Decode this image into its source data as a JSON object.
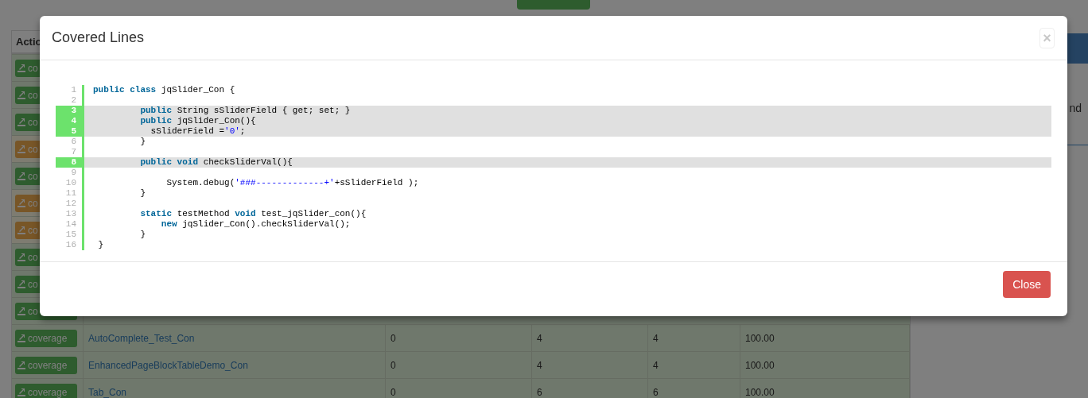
{
  "page": {
    "table": {
      "columns": [
        {
          "label": "Actio"
        }
      ],
      "rows": [
        {
          "kind": "success",
          "button": "co"
        },
        {
          "kind": "success",
          "button": "co"
        },
        {
          "kind": "success",
          "button": "co"
        },
        {
          "kind": "warning",
          "button": "co"
        },
        {
          "kind": "success",
          "button": "co"
        },
        {
          "kind": "warning",
          "button": "co"
        },
        {
          "kind": "warning",
          "button": "co"
        },
        {
          "kind": "success",
          "button": "co"
        },
        {
          "kind": "success",
          "button": "co"
        },
        {
          "kind": "success",
          "button": "co"
        },
        {
          "kind": "success",
          "button": "coverage",
          "cells": [
            "AutoComplete_Test_Con",
            "0",
            "4",
            "4",
            "100.00"
          ]
        },
        {
          "kind": "success",
          "button": "coverage",
          "cells": [
            "EnhancedPageBlockTableDemo_Con",
            "0",
            "4",
            "4",
            "100.00"
          ]
        },
        {
          "kind": "success",
          "button": "coverage",
          "cells": [
            "Tab_Con",
            "0",
            "6",
            "6",
            "100.00"
          ]
        }
      ]
    },
    "side_panel": {
      "text": "nd"
    }
  },
  "modal": {
    "title": "Covered Lines",
    "close_icon": "×",
    "code_lines": [
      {
        "number": "1",
        "covered": false,
        "tokens": [
          {
            "kind": "keyword",
            "text": "public class"
          },
          {
            "kind": "plain",
            "text": " jqSlider_Con {"
          }
        ]
      },
      {
        "number": "2",
        "covered": false
      },
      {
        "number": "3",
        "covered": true,
        "tokens": [
          {
            "kind": "keyword",
            "text": "         public"
          },
          {
            "kind": "plain",
            "text": " String sSliderField { get; set; }"
          }
        ]
      },
      {
        "number": "4",
        "covered": true,
        "tokens": [
          {
            "kind": "keyword",
            "text": "         public"
          },
          {
            "kind": "plain",
            "text": " jqSlider_Con(){"
          }
        ]
      },
      {
        "number": "5",
        "covered": true,
        "tokens": [
          {
            "kind": "plain",
            "text": "           sSliderField ="
          },
          {
            "kind": "string",
            "text": "'0'"
          },
          {
            "kind": "plain",
            "text": ";"
          }
        ]
      },
      {
        "number": "6",
        "covered": false,
        "tokens": [
          {
            "kind": "plain",
            "text": "         }"
          }
        ]
      },
      {
        "number": "7",
        "covered": false
      },
      {
        "number": "8",
        "covered": true,
        "tokens": [
          {
            "kind": "keyword",
            "text": "         public void"
          },
          {
            "kind": "plain",
            "text": " checkSliderVal(){"
          }
        ]
      },
      {
        "number": "9",
        "covered": false
      },
      {
        "number": "10",
        "covered": false,
        "tokens": [
          {
            "kind": "plain",
            "text": "              System.debug("
          },
          {
            "kind": "string",
            "text": "'###-------------+'"
          },
          {
            "kind": "plain",
            "text": "+sSliderField );"
          }
        ]
      },
      {
        "number": "11",
        "covered": false,
        "tokens": [
          {
            "kind": "plain",
            "text": "         }"
          }
        ]
      },
      {
        "number": "12",
        "covered": false
      },
      {
        "number": "13",
        "covered": false,
        "tokens": [
          {
            "kind": "keyword",
            "text": "         static"
          },
          {
            "kind": "plain",
            "text": " testMethod "
          },
          {
            "kind": "keyword",
            "text": "void"
          },
          {
            "kind": "plain",
            "text": " test_jqSlider_con(){"
          }
        ]
      },
      {
        "number": "14",
        "covered": false,
        "tokens": [
          {
            "kind": "keyword",
            "text": "             new"
          },
          {
            "kind": "plain",
            "text": " jqSlider_Con().checkSliderVal();"
          }
        ]
      },
      {
        "number": "15",
        "covered": false,
        "tokens": [
          {
            "kind": "plain",
            "text": "         }"
          }
        ]
      },
      {
        "number": "16",
        "covered": false,
        "tokens": [
          {
            "kind": "plain",
            "text": " }"
          }
        ]
      }
    ],
    "footer_button": "Close"
  }
}
